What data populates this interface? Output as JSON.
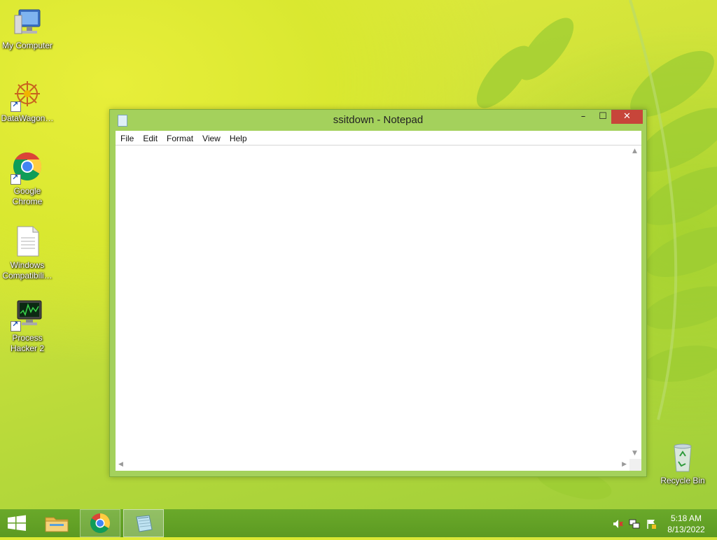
{
  "desktop": {
    "icons": [
      {
        "label": "My Computer",
        "icon": "computer-icon"
      },
      {
        "label": "DataWagon…",
        "icon": "datawagon-icon"
      },
      {
        "label": "Google\nChrome",
        "icon": "chrome-icon"
      },
      {
        "label": "Windows\nCompatibili…",
        "icon": "text-document-icon"
      },
      {
        "label": "Process\nHacker 2",
        "icon": "process-hacker-icon"
      },
      {
        "label": "Recycle Bin",
        "icon": "recycle-bin-icon"
      }
    ]
  },
  "window": {
    "title": "ssitdown - Notepad",
    "controls": {
      "minimize": "–",
      "maximize": "☐",
      "close": "✕"
    },
    "menu": [
      "File",
      "Edit",
      "Format",
      "View",
      "Help"
    ],
    "content": ""
  },
  "taskbar": {
    "apps": [
      "start-icon",
      "file-explorer-icon",
      "chrome-icon",
      "notepad-icon"
    ],
    "tray": [
      "volume-muted-icon",
      "network-icon",
      "action-center-flag-icon"
    ],
    "time": "5:18 AM",
    "date": "8/13/2022"
  },
  "colors": {
    "accent": "#a4d15c",
    "close": "#c7453a",
    "taskbar": "#62a126"
  }
}
